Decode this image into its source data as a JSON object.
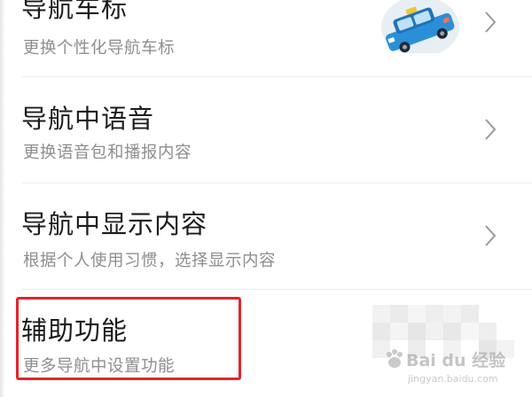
{
  "settings": {
    "items": [
      {
        "title": "导航车标",
        "subtitle": "更换个性化导航车标"
      },
      {
        "title": "导航中语音",
        "subtitle": "更换语音包和播报内容"
      },
      {
        "title": "导航中显示内容",
        "subtitle": "根据个人使用习惯，选择显示内容"
      },
      {
        "title": "辅助功能",
        "subtitle": "更多导航中设置功能"
      }
    ]
  },
  "icons": {
    "chevron": "chevron-right-icon",
    "vehicle": "taxi-car-icon"
  },
  "colors": {
    "highlight": "#e0262b",
    "car_blue": "#2b8fd8",
    "car_badge": "#f4c531"
  },
  "watermark": {
    "text": "Bai du 经验",
    "url": "jingyan.baidu.com"
  }
}
